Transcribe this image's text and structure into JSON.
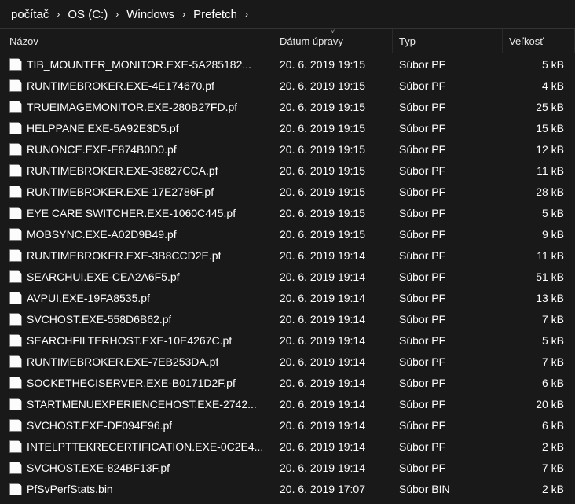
{
  "breadcrumb": {
    "items": [
      "počítač",
      "OS (C:)",
      "Windows",
      "Prefetch"
    ]
  },
  "columns": {
    "name": "Názov",
    "date": "Dátum úpravy",
    "type": "Typ",
    "size": "Veľkosť"
  },
  "sort_indicator": "˅",
  "files": [
    {
      "name": "TIB_MOUNTER_MONITOR.EXE-5A285182...",
      "date": "20. 6. 2019 19:15",
      "type": "Súbor PF",
      "size": "5 kB"
    },
    {
      "name": "RUNTIMEBROKER.EXE-4E174670.pf",
      "date": "20. 6. 2019 19:15",
      "type": "Súbor PF",
      "size": "4 kB"
    },
    {
      "name": "TRUEIMAGEMONITOR.EXE-280B27FD.pf",
      "date": "20. 6. 2019 19:15",
      "type": "Súbor PF",
      "size": "25 kB"
    },
    {
      "name": "HELPPANE.EXE-5A92E3D5.pf",
      "date": "20. 6. 2019 19:15",
      "type": "Súbor PF",
      "size": "15 kB"
    },
    {
      "name": "RUNONCE.EXE-E874B0D0.pf",
      "date": "20. 6. 2019 19:15",
      "type": "Súbor PF",
      "size": "12 kB"
    },
    {
      "name": "RUNTIMEBROKER.EXE-36827CCA.pf",
      "date": "20. 6. 2019 19:15",
      "type": "Súbor PF",
      "size": "11 kB"
    },
    {
      "name": "RUNTIMEBROKER.EXE-17E2786F.pf",
      "date": "20. 6. 2019 19:15",
      "type": "Súbor PF",
      "size": "28 kB"
    },
    {
      "name": "EYE CARE SWITCHER.EXE-1060C445.pf",
      "date": "20. 6. 2019 19:15",
      "type": "Súbor PF",
      "size": "5 kB"
    },
    {
      "name": "MOBSYNC.EXE-A02D9B49.pf",
      "date": "20. 6. 2019 19:15",
      "type": "Súbor PF",
      "size": "9 kB"
    },
    {
      "name": "RUNTIMEBROKER.EXE-3B8CCD2E.pf",
      "date": "20. 6. 2019 19:14",
      "type": "Súbor PF",
      "size": "11 kB"
    },
    {
      "name": "SEARCHUI.EXE-CEA2A6F5.pf",
      "date": "20. 6. 2019 19:14",
      "type": "Súbor PF",
      "size": "51 kB"
    },
    {
      "name": "AVPUI.EXE-19FA8535.pf",
      "date": "20. 6. 2019 19:14",
      "type": "Súbor PF",
      "size": "13 kB"
    },
    {
      "name": "SVCHOST.EXE-558D6B62.pf",
      "date": "20. 6. 2019 19:14",
      "type": "Súbor PF",
      "size": "7 kB"
    },
    {
      "name": "SEARCHFILTERHOST.EXE-10E4267C.pf",
      "date": "20. 6. 2019 19:14",
      "type": "Súbor PF",
      "size": "5 kB"
    },
    {
      "name": "RUNTIMEBROKER.EXE-7EB253DA.pf",
      "date": "20. 6. 2019 19:14",
      "type": "Súbor PF",
      "size": "7 kB"
    },
    {
      "name": "SOCKETHECISERVER.EXE-B0171D2F.pf",
      "date": "20. 6. 2019 19:14",
      "type": "Súbor PF",
      "size": "6 kB"
    },
    {
      "name": "STARTMENUEXPERIENCEHOST.EXE-2742...",
      "date": "20. 6. 2019 19:14",
      "type": "Súbor PF",
      "size": "20 kB"
    },
    {
      "name": "SVCHOST.EXE-DF094E96.pf",
      "date": "20. 6. 2019 19:14",
      "type": "Súbor PF",
      "size": "6 kB"
    },
    {
      "name": "INTELPTTEKRECERTIFICATION.EXE-0C2E4...",
      "date": "20. 6. 2019 19:14",
      "type": "Súbor PF",
      "size": "2 kB"
    },
    {
      "name": "SVCHOST.EXE-824BF13F.pf",
      "date": "20. 6. 2019 19:14",
      "type": "Súbor PF",
      "size": "7 kB"
    },
    {
      "name": "PfSvPerfStats.bin",
      "date": "20. 6. 2019 17:07",
      "type": "Súbor BIN",
      "size": "2 kB"
    }
  ]
}
